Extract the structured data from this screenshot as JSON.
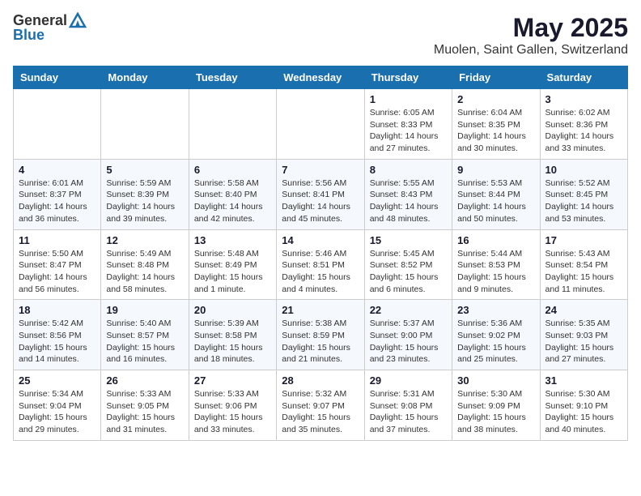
{
  "logo": {
    "general": "General",
    "blue": "Blue"
  },
  "title": {
    "month": "May 2025",
    "location": "Muolen, Saint Gallen, Switzerland"
  },
  "weekdays": [
    "Sunday",
    "Monday",
    "Tuesday",
    "Wednesday",
    "Thursday",
    "Friday",
    "Saturday"
  ],
  "weeks": [
    [
      {
        "num": "",
        "info": ""
      },
      {
        "num": "",
        "info": ""
      },
      {
        "num": "",
        "info": ""
      },
      {
        "num": "",
        "info": ""
      },
      {
        "num": "1",
        "info": "Sunrise: 6:05 AM\nSunset: 8:33 PM\nDaylight: 14 hours\nand 27 minutes."
      },
      {
        "num": "2",
        "info": "Sunrise: 6:04 AM\nSunset: 8:35 PM\nDaylight: 14 hours\nand 30 minutes."
      },
      {
        "num": "3",
        "info": "Sunrise: 6:02 AM\nSunset: 8:36 PM\nDaylight: 14 hours\nand 33 minutes."
      }
    ],
    [
      {
        "num": "4",
        "info": "Sunrise: 6:01 AM\nSunset: 8:37 PM\nDaylight: 14 hours\nand 36 minutes."
      },
      {
        "num": "5",
        "info": "Sunrise: 5:59 AM\nSunset: 8:39 PM\nDaylight: 14 hours\nand 39 minutes."
      },
      {
        "num": "6",
        "info": "Sunrise: 5:58 AM\nSunset: 8:40 PM\nDaylight: 14 hours\nand 42 minutes."
      },
      {
        "num": "7",
        "info": "Sunrise: 5:56 AM\nSunset: 8:41 PM\nDaylight: 14 hours\nand 45 minutes."
      },
      {
        "num": "8",
        "info": "Sunrise: 5:55 AM\nSunset: 8:43 PM\nDaylight: 14 hours\nand 48 minutes."
      },
      {
        "num": "9",
        "info": "Sunrise: 5:53 AM\nSunset: 8:44 PM\nDaylight: 14 hours\nand 50 minutes."
      },
      {
        "num": "10",
        "info": "Sunrise: 5:52 AM\nSunset: 8:45 PM\nDaylight: 14 hours\nand 53 minutes."
      }
    ],
    [
      {
        "num": "11",
        "info": "Sunrise: 5:50 AM\nSunset: 8:47 PM\nDaylight: 14 hours\nand 56 minutes."
      },
      {
        "num": "12",
        "info": "Sunrise: 5:49 AM\nSunset: 8:48 PM\nDaylight: 14 hours\nand 58 minutes."
      },
      {
        "num": "13",
        "info": "Sunrise: 5:48 AM\nSunset: 8:49 PM\nDaylight: 15 hours\nand 1 minute."
      },
      {
        "num": "14",
        "info": "Sunrise: 5:46 AM\nSunset: 8:51 PM\nDaylight: 15 hours\nand 4 minutes."
      },
      {
        "num": "15",
        "info": "Sunrise: 5:45 AM\nSunset: 8:52 PM\nDaylight: 15 hours\nand 6 minutes."
      },
      {
        "num": "16",
        "info": "Sunrise: 5:44 AM\nSunset: 8:53 PM\nDaylight: 15 hours\nand 9 minutes."
      },
      {
        "num": "17",
        "info": "Sunrise: 5:43 AM\nSunset: 8:54 PM\nDaylight: 15 hours\nand 11 minutes."
      }
    ],
    [
      {
        "num": "18",
        "info": "Sunrise: 5:42 AM\nSunset: 8:56 PM\nDaylight: 15 hours\nand 14 minutes."
      },
      {
        "num": "19",
        "info": "Sunrise: 5:40 AM\nSunset: 8:57 PM\nDaylight: 15 hours\nand 16 minutes."
      },
      {
        "num": "20",
        "info": "Sunrise: 5:39 AM\nSunset: 8:58 PM\nDaylight: 15 hours\nand 18 minutes."
      },
      {
        "num": "21",
        "info": "Sunrise: 5:38 AM\nSunset: 8:59 PM\nDaylight: 15 hours\nand 21 minutes."
      },
      {
        "num": "22",
        "info": "Sunrise: 5:37 AM\nSunset: 9:00 PM\nDaylight: 15 hours\nand 23 minutes."
      },
      {
        "num": "23",
        "info": "Sunrise: 5:36 AM\nSunset: 9:02 PM\nDaylight: 15 hours\nand 25 minutes."
      },
      {
        "num": "24",
        "info": "Sunrise: 5:35 AM\nSunset: 9:03 PM\nDaylight: 15 hours\nand 27 minutes."
      }
    ],
    [
      {
        "num": "25",
        "info": "Sunrise: 5:34 AM\nSunset: 9:04 PM\nDaylight: 15 hours\nand 29 minutes."
      },
      {
        "num": "26",
        "info": "Sunrise: 5:33 AM\nSunset: 9:05 PM\nDaylight: 15 hours\nand 31 minutes."
      },
      {
        "num": "27",
        "info": "Sunrise: 5:33 AM\nSunset: 9:06 PM\nDaylight: 15 hours\nand 33 minutes."
      },
      {
        "num": "28",
        "info": "Sunrise: 5:32 AM\nSunset: 9:07 PM\nDaylight: 15 hours\nand 35 minutes."
      },
      {
        "num": "29",
        "info": "Sunrise: 5:31 AM\nSunset: 9:08 PM\nDaylight: 15 hours\nand 37 minutes."
      },
      {
        "num": "30",
        "info": "Sunrise: 5:30 AM\nSunset: 9:09 PM\nDaylight: 15 hours\nand 38 minutes."
      },
      {
        "num": "31",
        "info": "Sunrise: 5:30 AM\nSunset: 9:10 PM\nDaylight: 15 hours\nand 40 minutes."
      }
    ]
  ]
}
